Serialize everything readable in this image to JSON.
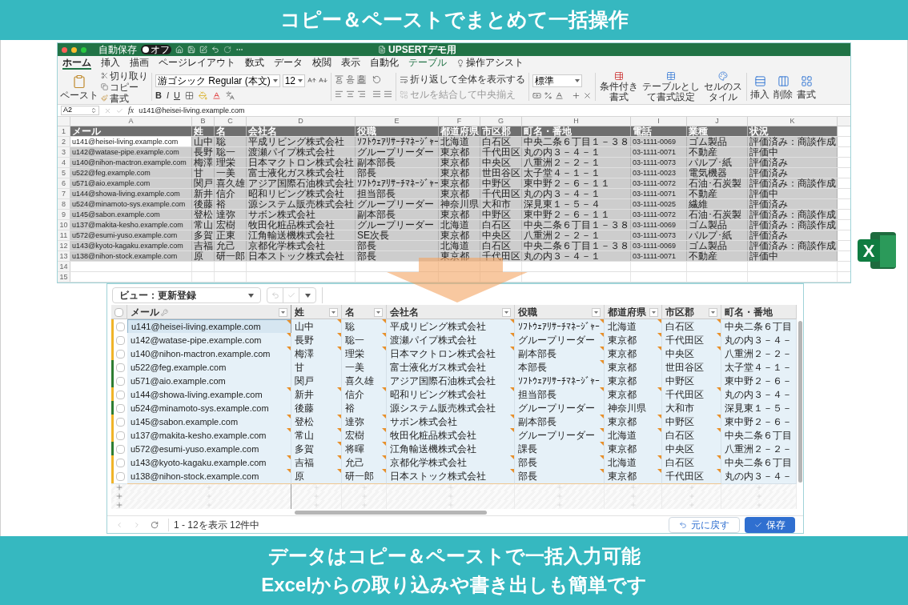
{
  "header": {
    "title": "コピー＆ペーストでまとめて一括操作"
  },
  "excel": {
    "autosave_label": "自動保存",
    "autosave_state": "オフ",
    "autosave_on": false,
    "title": "UPSERTデモ用",
    "logo_letter": "X",
    "tabs": [
      {
        "label": "ホーム",
        "selected": true,
        "kind": "tab"
      },
      {
        "label": "挿入",
        "selected": false,
        "kind": "tab"
      },
      {
        "label": "描画",
        "selected": false,
        "kind": "tab"
      },
      {
        "label": "ページレイアウト",
        "selected": false,
        "kind": "tab"
      },
      {
        "label": "数式",
        "selected": false,
        "kind": "tab"
      },
      {
        "label": "データ",
        "selected": false,
        "kind": "tab"
      },
      {
        "label": "校閲",
        "selected": false,
        "kind": "tab"
      },
      {
        "label": "表示",
        "selected": false,
        "kind": "tab"
      },
      {
        "label": "自動化",
        "selected": false,
        "kind": "tab"
      },
      {
        "label": "テーブル",
        "selected": false,
        "kind": "contextual"
      },
      {
        "label": "操作アシスト",
        "selected": false,
        "kind": "assist"
      }
    ],
    "ribbon": {
      "paste": "ペースト",
      "cut": "切り取り",
      "copy": "コピー",
      "format_painter": "書式",
      "font": "游ゴシック Regular (本文)",
      "size": "12",
      "font_buttons": [
        "B",
        "I",
        "U"
      ],
      "wrap": "折り返して全体を表示する",
      "merge": "セルを結合して中央揃え",
      "merge_disabled": true,
      "number_format": "標準",
      "conditional": "条件付き書式",
      "table": "テーブルとして書式設定",
      "cell_style": "セルのスタイル",
      "insert": "挿入",
      "delete": "削除",
      "format": "書式"
    },
    "name_box": "A2",
    "fx": "fx",
    "formula": "u141@heisei-living.example.com",
    "columns": [
      "A",
      "B",
      "C",
      "D",
      "E",
      "F",
      "G",
      "H",
      "I",
      "J",
      "K"
    ],
    "row_numbers": [
      "1",
      "2",
      "3",
      "4",
      "5",
      "6",
      "7",
      "8",
      "9",
      "10",
      "11",
      "12",
      "13",
      "14",
      "15"
    ],
    "header": [
      "メール",
      "姓",
      "名",
      "会社名",
      "役職",
      "都道府県",
      "市区郡",
      "町名・番地",
      "電話",
      "業種",
      "状況"
    ],
    "rows": [
      {
        "active": true,
        "cells": [
          "u141@heisei-living.example.com",
          "山中",
          "聡",
          "平成リビング株式会社",
          "ｿﾌﾄｳｪｱﾘｻｰﾁﾏﾈｰｼﾞｬｰ",
          "北海道",
          "白石区",
          "中央二条６丁目１－３８",
          "03-1111-0069",
          "ゴム製品",
          "評価済み：商談作成"
        ]
      },
      {
        "active": false,
        "cells": [
          "u142@watase-pipe.example.com",
          "長野",
          "聡一",
          "渡瀬パイプ株式会社",
          "グループリーダー",
          "東京都",
          "千代田区",
          "丸の内３－４－１",
          "03-1111-0071",
          "不動産",
          "評価中"
        ]
      },
      {
        "active": false,
        "cells": [
          "u140@nihon-mactron.example.com",
          "梅澤",
          "理栄",
          "日本マクトロン株式会社",
          "副本部長",
          "東京都",
          "中央区",
          "八重洲２－２－１",
          "03-1111-0073",
          "パルプ･紙",
          "評価済み"
        ]
      },
      {
        "active": false,
        "cells": [
          "u522@feg.example.com",
          "甘",
          "一美",
          "富士液化ガス株式会社",
          "部長",
          "東京都",
          "世田谷区",
          "太子堂４－１－１",
          "03-1111-0023",
          "電気機器",
          "評価済み"
        ]
      },
      {
        "active": false,
        "cells": [
          "u571@aio.example.com",
          "関戸",
          "喜久雄",
          "アジア国際石油株式会社",
          "ｿﾌﾄｳｪｱﾘｻｰﾁﾏﾈｰｼﾞｬｰ",
          "東京都",
          "中野区",
          "東中野２－６－１１",
          "03-1111-0072",
          "石油･石炭製",
          "評価済み：商談作成"
        ]
      },
      {
        "active": false,
        "cells": [
          "u144@showa-living.example.com",
          "新井",
          "信介",
          "昭和リビング株式会社",
          "担当部長",
          "東京都",
          "千代田区",
          "丸の内３－４－１",
          "03-1111-0071",
          "不動産",
          "評価中"
        ]
      },
      {
        "active": false,
        "cells": [
          "u524@minamoto-sys.example.com",
          "後藤",
          "裕",
          "源システム販売株式会社",
          "グループリーダー",
          "神奈川県",
          "大和市",
          "深見東１－５－４",
          "03-1111-0025",
          "繊維",
          "評価済み"
        ]
      },
      {
        "active": false,
        "cells": [
          "u145@sabon.example.com",
          "登松",
          "達弥",
          "サボン株式会社",
          "副本部長",
          "東京都",
          "中野区",
          "東中野２－６－１１",
          "03-1111-0072",
          "石油･石炭製",
          "評価済み：商談作成"
        ]
      },
      {
        "active": false,
        "cells": [
          "u137@makita-kesho.example.com",
          "常山",
          "宏樹",
          "牧田化粧品株式会社",
          "グループリーダー",
          "北海道",
          "白石区",
          "中央二条６丁目１－３８",
          "03-1111-0069",
          "ゴム製品",
          "評価済み：商談作成"
        ]
      },
      {
        "active": false,
        "cells": [
          "u572@esumi-yuso.example.com",
          "多賀",
          "正東",
          "江角輸送機株式会社",
          "SE次長",
          "東京都",
          "中央区",
          "八重洲２－２－１",
          "03-1111-0073",
          "パルプ･紙",
          "評価済み"
        ]
      },
      {
        "active": false,
        "cells": [
          "u143@kyoto-kagaku.example.com",
          "吉福",
          "允己",
          "京都化学株式会社",
          "部長",
          "北海道",
          "白石区",
          "中央二条６丁目１－３８",
          "03-1111-0069",
          "ゴム製品",
          "評価済み：商談作成"
        ]
      },
      {
        "active": false,
        "cells": [
          "u138@nihon-stock.example.com",
          "原",
          "研一郎",
          "日本ストック株式会社",
          "部長",
          "東京都",
          "千代田区",
          "丸の内３－４－１",
          "03-1111-0071",
          "不動産",
          "評価中"
        ]
      }
    ]
  },
  "grid": {
    "view_select": "ビュー：更新登録",
    "select_all_checked": false,
    "columns": [
      {
        "label": "メール",
        "key": true,
        "filter": true
      },
      {
        "label": "姓",
        "key": false,
        "filter": true
      },
      {
        "label": "名",
        "key": false,
        "filter": true
      },
      {
        "label": "会社名",
        "key": false,
        "filter": true
      },
      {
        "label": "役職",
        "key": false,
        "filter": true
      },
      {
        "label": "都道府県",
        "key": false,
        "filter": true
      },
      {
        "label": "市区郡",
        "key": false,
        "filter": true
      },
      {
        "label": "町名・番地",
        "key": false,
        "filter": false
      }
    ],
    "rows": [
      {
        "color": "#f0b429",
        "checked": false,
        "selected": true,
        "cells": [
          {
            "text": "u141@heisei-living.example.com",
            "changed": true
          },
          {
            "text": "山中",
            "changed": true
          },
          {
            "text": "聡",
            "changed": true
          },
          {
            "text": "平成リビング株式会社",
            "changed": true
          },
          {
            "text": "ｿﾌﾄｳｪｱﾘｻｰﾁﾏﾈｰｼﾞｬｰ",
            "changed": true
          },
          {
            "text": "北海道",
            "changed": true
          },
          {
            "text": "白石区",
            "changed": true
          },
          {
            "text": "中央二条６丁目",
            "changed": false
          }
        ]
      },
      {
        "color": "#f0b429",
        "checked": false,
        "selected": false,
        "cells": [
          {
            "text": "u142@watase-pipe.example.com",
            "changed": true
          },
          {
            "text": "長野",
            "changed": true
          },
          {
            "text": "聡一",
            "changed": true
          },
          {
            "text": "渡瀬パイプ株式会社",
            "changed": true
          },
          {
            "text": "グループリーダー",
            "changed": true
          },
          {
            "text": "東京都",
            "changed": true
          },
          {
            "text": "千代田区",
            "changed": true
          },
          {
            "text": "丸の内３－４－",
            "changed": false
          }
        ]
      },
      {
        "color": "#f0b429",
        "checked": false,
        "selected": false,
        "cells": [
          {
            "text": "u140@nihon-mactron.example.com",
            "changed": true
          },
          {
            "text": "梅澤",
            "changed": true
          },
          {
            "text": "理栄",
            "changed": true
          },
          {
            "text": "日本マクトロン株式会社",
            "changed": true
          },
          {
            "text": "副本部長",
            "changed": true
          },
          {
            "text": "東京都",
            "changed": true
          },
          {
            "text": "中央区",
            "changed": true
          },
          {
            "text": "八重洲２－２－",
            "changed": false
          }
        ]
      },
      {
        "color": "#2e7d32",
        "checked": false,
        "selected": false,
        "cells": [
          {
            "text": "u522@feg.example.com",
            "changed": false
          },
          {
            "text": "甘",
            "changed": false
          },
          {
            "text": "一美",
            "changed": false
          },
          {
            "text": "富士液化ガス株式会社",
            "changed": false
          },
          {
            "text": "本部長",
            "changed": true
          },
          {
            "text": "東京都",
            "changed": false
          },
          {
            "text": "世田谷区",
            "changed": false
          },
          {
            "text": "太子堂４－１－",
            "changed": false
          }
        ]
      },
      {
        "color": "#2e7d32",
        "checked": false,
        "selected": false,
        "cells": [
          {
            "text": "u571@aio.example.com",
            "changed": false
          },
          {
            "text": "関戸",
            "changed": false
          },
          {
            "text": "喜久雄",
            "changed": false
          },
          {
            "text": "アジア国際石油株式会社",
            "changed": false
          },
          {
            "text": "ｿﾌﾄｳｪｱﾘｻｰﾁﾏﾈｰｼﾞｬｰ",
            "changed": false
          },
          {
            "text": "東京都",
            "changed": false
          },
          {
            "text": "中野区",
            "changed": false
          },
          {
            "text": "東中野２－６－",
            "changed": false
          }
        ]
      },
      {
        "color": "#f0b429",
        "checked": false,
        "selected": false,
        "cells": [
          {
            "text": "u144@showa-living.example.com",
            "changed": true
          },
          {
            "text": "新井",
            "changed": true
          },
          {
            "text": "信介",
            "changed": true
          },
          {
            "text": "昭和リビング株式会社",
            "changed": true
          },
          {
            "text": "担当部長",
            "changed": true
          },
          {
            "text": "東京都",
            "changed": true
          },
          {
            "text": "千代田区",
            "changed": true
          },
          {
            "text": "丸の内３－４－",
            "changed": false
          }
        ]
      },
      {
        "color": "#2e7d32",
        "checked": false,
        "selected": false,
        "cells": [
          {
            "text": "u524@minamoto-sys.example.com",
            "changed": false
          },
          {
            "text": "後藤",
            "changed": false
          },
          {
            "text": "裕",
            "changed": false
          },
          {
            "text": "源システム販売株式会社",
            "changed": false
          },
          {
            "text": "グループリーダー",
            "changed": false
          },
          {
            "text": "神奈川県",
            "changed": false
          },
          {
            "text": "大和市",
            "changed": false
          },
          {
            "text": "深見東１－５－",
            "changed": false
          }
        ]
      },
      {
        "color": "#f0b429",
        "checked": false,
        "selected": false,
        "cells": [
          {
            "text": "u145@sabon.example.com",
            "changed": true
          },
          {
            "text": "登松",
            "changed": true
          },
          {
            "text": "達弥",
            "changed": true
          },
          {
            "text": "サボン株式会社",
            "changed": true
          },
          {
            "text": "副本部長",
            "changed": true
          },
          {
            "text": "東京都",
            "changed": true
          },
          {
            "text": "中野区",
            "changed": true
          },
          {
            "text": "東中野２－６－",
            "changed": false
          }
        ]
      },
      {
        "color": "#f0b429",
        "checked": false,
        "selected": false,
        "cells": [
          {
            "text": "u137@makita-kesho.example.com",
            "changed": true
          },
          {
            "text": "常山",
            "changed": true
          },
          {
            "text": "宏樹",
            "changed": true
          },
          {
            "text": "牧田化粧品株式会社",
            "changed": true
          },
          {
            "text": "グループリーダー",
            "changed": true
          },
          {
            "text": "北海道",
            "changed": true
          },
          {
            "text": "白石区",
            "changed": true
          },
          {
            "text": "中央二条６丁目",
            "changed": false
          }
        ]
      },
      {
        "color": "#2e7d32",
        "checked": false,
        "selected": false,
        "cells": [
          {
            "text": "u572@esumi-yuso.example.com",
            "changed": false
          },
          {
            "text": "多賀",
            "changed": true
          },
          {
            "text": "将暉",
            "changed": true
          },
          {
            "text": "江角輸送機株式会社",
            "changed": false
          },
          {
            "text": "課長",
            "changed": true
          },
          {
            "text": "東京都",
            "changed": false
          },
          {
            "text": "中央区",
            "changed": false
          },
          {
            "text": "八重洲２－２－",
            "changed": false
          }
        ]
      },
      {
        "color": "#f0b429",
        "checked": false,
        "selected": false,
        "cells": [
          {
            "text": "u143@kyoto-kagaku.example.com",
            "changed": true
          },
          {
            "text": "吉福",
            "changed": true
          },
          {
            "text": "允己",
            "changed": true
          },
          {
            "text": "京都化学株式会社",
            "changed": true
          },
          {
            "text": "部長",
            "changed": true
          },
          {
            "text": "北海道",
            "changed": true
          },
          {
            "text": "白石区",
            "changed": true
          },
          {
            "text": "中央二条６丁目",
            "changed": false
          }
        ]
      },
      {
        "color": "#f0b429",
        "checked": false,
        "selected": false,
        "cells": [
          {
            "text": "u138@nihon-stock.example.com",
            "changed": true
          },
          {
            "text": "原",
            "changed": true
          },
          {
            "text": "研一郎",
            "changed": true
          },
          {
            "text": "日本ストック株式会社",
            "changed": true
          },
          {
            "text": "部長",
            "changed": true
          },
          {
            "text": "東京都",
            "changed": true
          },
          {
            "text": "千代田区",
            "changed": true
          },
          {
            "text": "丸の内３－４－",
            "changed": false
          }
        ]
      }
    ],
    "pager": "1 - 12を表示 12件中",
    "undo_button": "元に戻す",
    "save_button": "保存"
  },
  "footer": {
    "lines": [
      "データはコピー＆ペーストで一括入力可能",
      "Excelからの取り込みや書き出しも簡単です"
    ]
  }
}
